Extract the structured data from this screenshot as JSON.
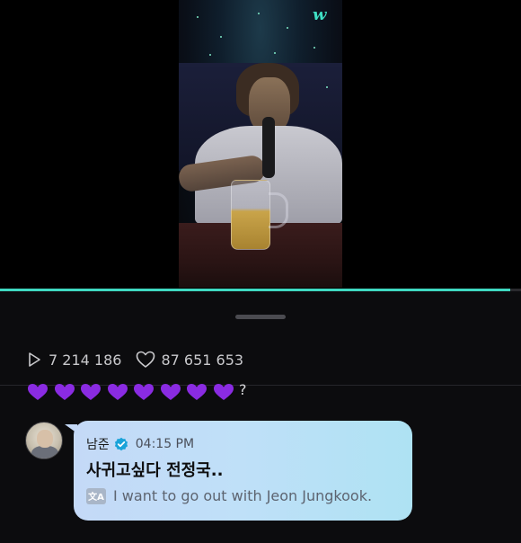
{
  "app": {
    "brand_logo": "w",
    "accent_color": "#3fd9c1",
    "playback_progress": 0.98
  },
  "stats": {
    "views": "7 214 186",
    "likes": "87 651 653",
    "view_icon": "play-outline-icon",
    "like_icon": "heart-outline-icon"
  },
  "previous_comment": {
    "purple_hearts": 8,
    "trailing_text": "?",
    "heart_color": "#8a2be2"
  },
  "comment": {
    "author": "남준",
    "verified_icon": "verified-badge-icon",
    "time": "04:15 PM",
    "message": "사귀고싶다 전정국..",
    "translation_icon": "translate-icon",
    "translation_icon_text": "文A",
    "translation": "I want to go out with Jeon Jungkook."
  }
}
